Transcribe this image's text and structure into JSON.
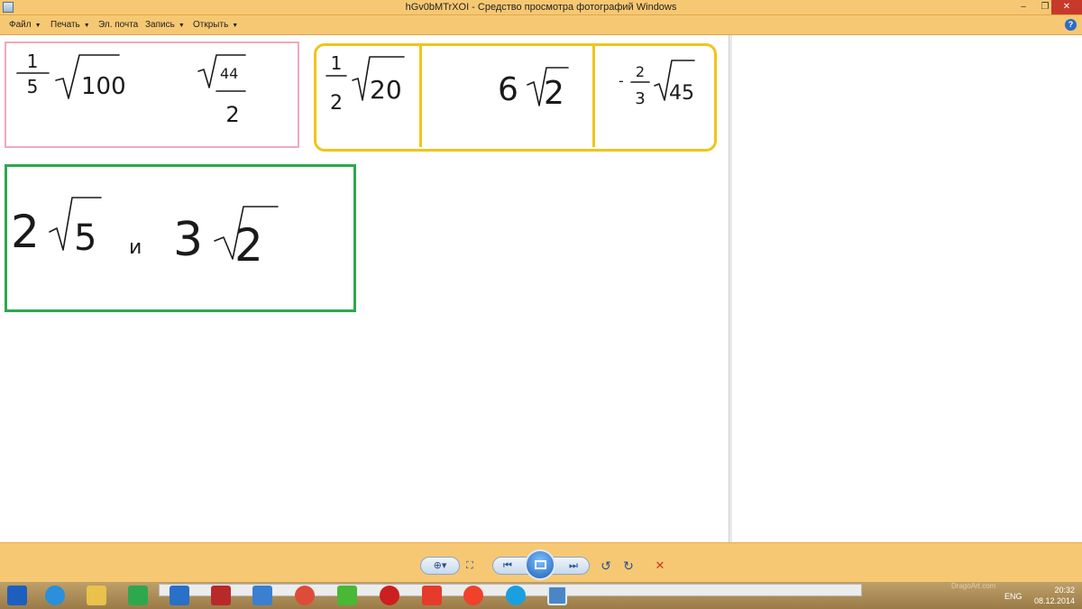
{
  "window": {
    "title": "hGv0bMTrXOI - Средство просмотра фотографий Windows",
    "minimize_glyph": "–",
    "maximize_glyph": "❐",
    "close_glyph": "✕"
  },
  "menu": {
    "items": [
      {
        "label": "Файл",
        "has_dropdown": true
      },
      {
        "label": "Печать",
        "has_dropdown": true
      },
      {
        "label": "Эл. почта",
        "has_dropdown": false
      },
      {
        "label": "Запись",
        "has_dropdown": true
      },
      {
        "label": "Открыть",
        "has_dropdown": true
      }
    ],
    "dropdown_glyph": "▼",
    "help_glyph": "?"
  },
  "photo": {
    "pink_box": {
      "items": [
        {
          "coef_num": "1",
          "coef_den": "5",
          "radicand": "100"
        },
        {
          "radicand": "44",
          "den": "2"
        }
      ]
    },
    "yellow_box": {
      "items": [
        {
          "coef_num": "1",
          "coef_den": "2",
          "radicand": "20"
        },
        {
          "coef": "6",
          "radicand": "2"
        },
        {
          "sign": "-",
          "coef_num": "2",
          "coef_den": "3",
          "radicand": "45"
        }
      ]
    },
    "green_box": {
      "left": {
        "coef": "2",
        "radicand": "5"
      },
      "conjunction": "и",
      "right": {
        "coef": "3",
        "radicand": "2"
      }
    },
    "colors": {
      "pink": "#f0a9bd",
      "yellow": "#f2c41a",
      "green": "#2ea84e",
      "ink": "#1a1a1a"
    }
  },
  "toolbar": {
    "buttons": [
      {
        "name": "zoom-button",
        "icon": "magnifier-icon",
        "glyph": "⊕▾"
      },
      {
        "name": "actual-size-button",
        "icon": "fit-window-icon",
        "glyph": "⛶"
      },
      {
        "name": "previous-button",
        "icon": "previous-icon",
        "glyph": "⏮"
      },
      {
        "name": "slideshow-button",
        "icon": "slideshow-icon",
        "glyph": ""
      },
      {
        "name": "next-button",
        "icon": "next-icon",
        "glyph": "⏭"
      },
      {
        "name": "rotate-left-button",
        "icon": "rotate-ccw-icon",
        "glyph": "↺"
      },
      {
        "name": "rotate-right-button",
        "icon": "rotate-cw-icon",
        "glyph": "↻"
      },
      {
        "name": "delete-button",
        "icon": "delete-icon",
        "glyph": "✕"
      }
    ]
  },
  "taskbar": {
    "apps": [
      {
        "name": "start-button",
        "color": "#1d5fbf"
      },
      {
        "name": "internet-explorer",
        "color": "#2a8fdc"
      },
      {
        "name": "file-explorer",
        "color": "#e8c24a"
      },
      {
        "name": "store",
        "color": "#2ea84e"
      },
      {
        "name": "app-blue",
        "color": "#2870c9"
      },
      {
        "name": "app-power",
        "color": "#b82a2a"
      },
      {
        "name": "app-audio",
        "color": "#3b7fd0"
      },
      {
        "name": "chrome",
        "color": "#dd4b39"
      },
      {
        "name": "app-green-a",
        "color": "#49b834"
      },
      {
        "name": "opera",
        "color": "#cc1f1f"
      },
      {
        "name": "yandex",
        "color": "#e53b2c"
      },
      {
        "name": "yandex-browser",
        "color": "#f0412b"
      },
      {
        "name": "skype",
        "color": "#1a9fe0"
      },
      {
        "name": "photo-viewer",
        "color": "#4a86c7"
      }
    ],
    "language": "ENG",
    "time": "20:32",
    "date": "08.12.2014",
    "watermark": "DragoArt.com"
  }
}
